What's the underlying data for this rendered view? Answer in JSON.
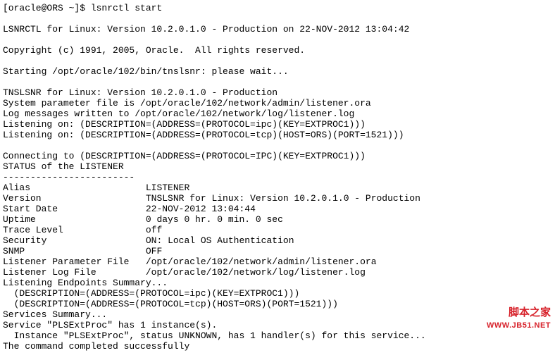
{
  "prompt": "[oracle@ORS ~]$ ",
  "command": "lsnrctl start",
  "banner1": "LSNRCTL for Linux: Version 10.2.0.1.0 - Production on 22-NOV-2012 13:04:42",
  "copyright": "Copyright (c) 1991, 2005, Oracle.  All rights reserved.",
  "starting": "Starting /opt/oracle/102/bin/tnslsnr: please wait...",
  "tnslsnr_line": "TNSLSNR for Linux: Version 10.2.0.1.0 - Production",
  "sys_param": "System parameter file is /opt/oracle/102/network/admin/listener.ora",
  "log_msgs": "Log messages written to /opt/oracle/102/network/log/listener.log",
  "listen1": "Listening on: (DESCRIPTION=(ADDRESS=(PROTOCOL=ipc)(KEY=EXTPROC1)))",
  "listen2": "Listening on: (DESCRIPTION=(ADDRESS=(PROTOCOL=tcp)(HOST=ORS)(PORT=1521)))",
  "connecting": "Connecting to (DESCRIPTION=(ADDRESS=(PROTOCOL=IPC)(KEY=EXTPROC1)))",
  "status_hdr": "STATUS of the LISTENER",
  "dashes": "------------------------",
  "rows": {
    "alias": {
      "label": "Alias",
      "value": "LISTENER"
    },
    "version": {
      "label": "Version",
      "value": "TNSLSNR for Linux: Version 10.2.0.1.0 - Production"
    },
    "start_date": {
      "label": "Start Date",
      "value": "22-NOV-2012 13:04:44"
    },
    "uptime": {
      "label": "Uptime",
      "value": "0 days 0 hr. 0 min. 0 sec"
    },
    "trace_level": {
      "label": "Trace Level",
      "value": "off"
    },
    "security": {
      "label": "Security",
      "value": "ON: Local OS Authentication"
    },
    "snmp": {
      "label": "SNMP",
      "value": "OFF"
    },
    "param_file": {
      "label": "Listener Parameter File",
      "value": "/opt/oracle/102/network/admin/listener.ora"
    },
    "log_file": {
      "label": "Listener Log File",
      "value": "/opt/oracle/102/network/log/listener.log"
    }
  },
  "endpoints_hdr": "Listening Endpoints Summary...",
  "endpoint1": "  (DESCRIPTION=(ADDRESS=(PROTOCOL=ipc)(KEY=EXTPROC1)))",
  "endpoint2": "  (DESCRIPTION=(ADDRESS=(PROTOCOL=tcp)(HOST=ORS)(PORT=1521)))",
  "services_hdr": "Services Summary...",
  "service_line": "Service \"PLSExtProc\" has 1 instance(s).",
  "instance_line": "  Instance \"PLSExtProc\", status UNKNOWN, has 1 handler(s) for this service...",
  "completed": "The command completed successfully",
  "watermark": {
    "line1": "脚本之家",
    "line2": "WWW.JB51.NET"
  }
}
